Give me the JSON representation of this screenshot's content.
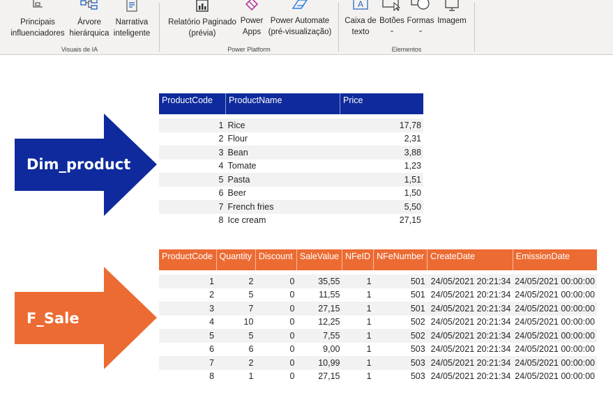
{
  "ribbon": {
    "groups": [
      {
        "label": "Visuais de IA",
        "buttons": [
          {
            "line1": "Principais",
            "line2": "influenciadores",
            "icon": "key-influencers-icon"
          },
          {
            "line1": "Árvore",
            "line2": "hierárquica",
            "icon": "decomposition-tree-icon"
          },
          {
            "line1": "Narrativa",
            "line2": "inteligente",
            "icon": "smart-narrative-icon"
          }
        ]
      },
      {
        "label": "Power Platform",
        "buttons": [
          {
            "line1": "Relatório Paginado",
            "line2": "(prévia)",
            "icon": "paginated-report-icon"
          },
          {
            "line1": "Power",
            "line2": "Apps",
            "icon": "power-apps-icon"
          },
          {
            "line1": "Power Automate",
            "line2": "(pré-visualização)",
            "icon": "power-automate-icon"
          }
        ]
      },
      {
        "label": "Elementos",
        "buttons": [
          {
            "line1": "Caixa de",
            "line2": "texto",
            "icon": "text-box-icon"
          },
          {
            "line1": "Botões",
            "line2": "⌄",
            "icon": "buttons-icon"
          },
          {
            "line1": "Formas",
            "line2": "⌄",
            "icon": "shapes-icon"
          },
          {
            "line1": "Imagem",
            "line2": "",
            "icon": "image-icon"
          }
        ]
      }
    ]
  },
  "arrows": {
    "dim": {
      "label": "Dim_product",
      "color": "#0e2a9c"
    },
    "fact": {
      "label": "F_Sale",
      "color": "#ec6b33"
    }
  },
  "dim_product": {
    "columns": [
      "ProductCode",
      "ProductName",
      "Price"
    ],
    "rows": [
      [
        "1",
        "Rice",
        "17,78"
      ],
      [
        "2",
        "Flour",
        "2,31"
      ],
      [
        "3",
        "Bean",
        "3,88"
      ],
      [
        "4",
        "Tomate",
        "1,23"
      ],
      [
        "5",
        "Pasta",
        "1,51"
      ],
      [
        "6",
        "Beer",
        "1,50"
      ],
      [
        "7",
        "French fries",
        "5,50"
      ],
      [
        "8",
        "Ice cream",
        "27,15"
      ]
    ]
  },
  "f_sale": {
    "columns": [
      "ProductCode",
      "Quantity",
      "Discount",
      "SaleValue",
      "NFeID",
      "NFeNumber",
      "CreateDate",
      "EmissionDate"
    ],
    "rows": [
      [
        "1",
        "2",
        "0",
        "35,55",
        "1",
        "501",
        "24/05/2021 20:21:34",
        "24/05/2021 00:00:00"
      ],
      [
        "2",
        "5",
        "0",
        "11,55",
        "1",
        "501",
        "24/05/2021 20:21:34",
        "24/05/2021 00:00:00"
      ],
      [
        "3",
        "7",
        "0",
        "27,15",
        "1",
        "501",
        "24/05/2021 20:21:34",
        "24/05/2021 00:00:00"
      ],
      [
        "4",
        "10",
        "0",
        "12,25",
        "1",
        "502",
        "24/05/2021 20:21:34",
        "24/05/2021 00:00:00"
      ],
      [
        "5",
        "5",
        "0",
        "7,55",
        "1",
        "502",
        "24/05/2021 20:21:34",
        "24/05/2021 00:00:00"
      ],
      [
        "6",
        "6",
        "0",
        "9,00",
        "1",
        "503",
        "24/05/2021 20:21:34",
        "24/05/2021 00:00:00"
      ],
      [
        "7",
        "2",
        "0",
        "10,99",
        "1",
        "503",
        "24/05/2021 20:21:34",
        "24/05/2021 00:00:00"
      ],
      [
        "8",
        "1",
        "0",
        "27,15",
        "1",
        "503",
        "24/05/2021 20:21:34",
        "24/05/2021 00:00:00"
      ]
    ]
  }
}
